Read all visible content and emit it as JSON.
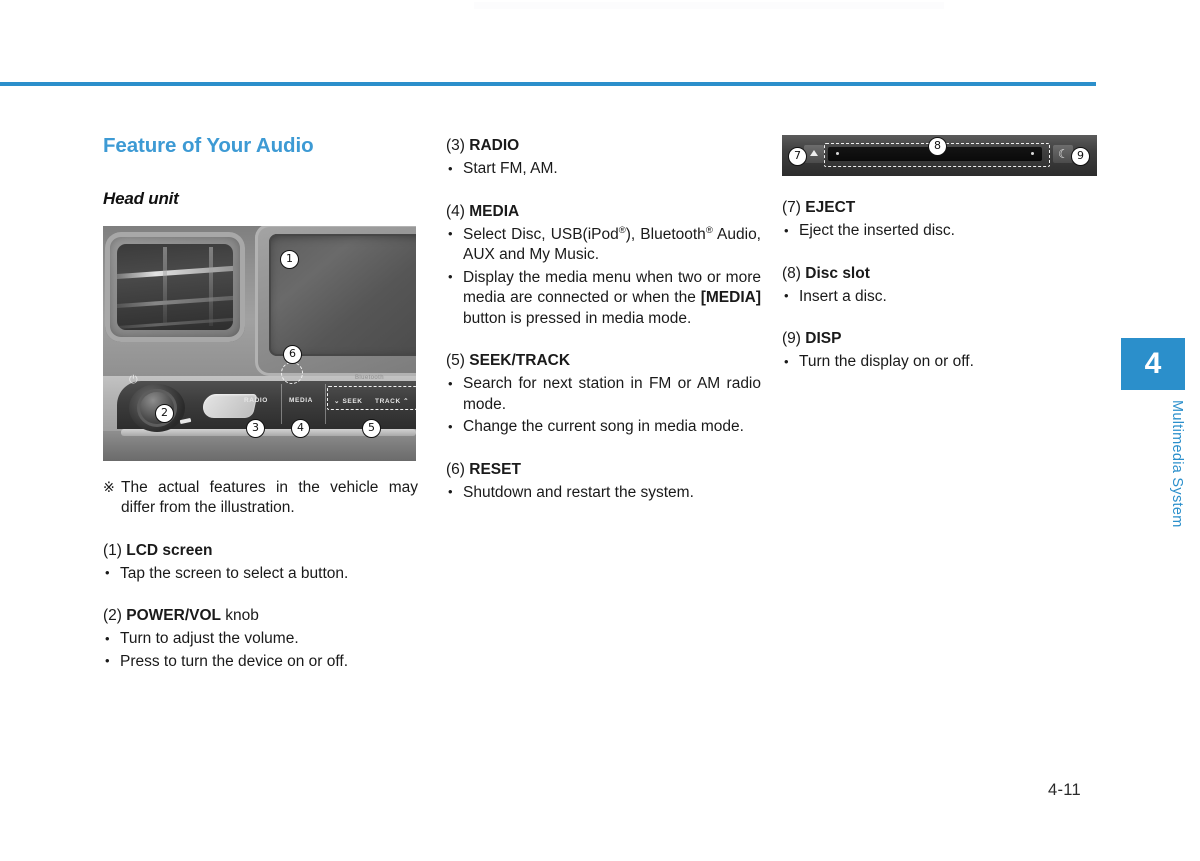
{
  "page": {
    "number": "4-11",
    "chapter_tab": "4",
    "chapter_label": "Multimedia System",
    "accent_color": "#2b8fcb",
    "heading_color": "#3d9ad4"
  },
  "left_column": {
    "section_title": "Feature of Your Audio",
    "sub_title": "Head unit",
    "head_unit_image": {
      "alt": "Head unit with air vent, LCD screen and control panel",
      "callouts": [
        "1",
        "2",
        "3",
        "4",
        "5",
        "6"
      ],
      "key_labels": {
        "radio": "RADIO",
        "media": "MEDIA",
        "seek": "SEEK",
        "track": "TRACK",
        "bluetooth": "Bluetooth",
        "power": "⏻"
      }
    },
    "note": {
      "mark": "※",
      "text": "The actual features in the vehicle may differ from the illustration."
    },
    "items": [
      {
        "num": "(1)",
        "name": "LCD screen",
        "suffix": "",
        "bullets": [
          {
            "text": "Tap the screen to select a button."
          }
        ]
      },
      {
        "num": "(2)",
        "name": "POWER/VOL",
        "suffix": " knob",
        "bullets": [
          {
            "text": "Turn to adjust the volume."
          },
          {
            "text": "Press to turn the device on or off."
          }
        ]
      }
    ]
  },
  "middle_column": {
    "items": [
      {
        "num": "(3)",
        "name": "RADIO",
        "suffix": "",
        "bullets": [
          {
            "text": "Start FM, AM."
          }
        ]
      },
      {
        "num": "(4)",
        "name": "MEDIA",
        "suffix": "",
        "bullets": [
          {
            "html": "Select Disc, USB(iPod<sup>®</sup>), Bluetooth<sup>®</sup> Audio, AUX and My Music."
          },
          {
            "html": "Display the media menu when two or more media are connected or when the <b>[MEDIA]</b> button is pressed in media mode."
          }
        ]
      },
      {
        "num": "(5)",
        "name": "SEEK/TRACK",
        "suffix": "",
        "bullets": [
          {
            "text": "Search for next station in FM or AM radio mode."
          },
          {
            "text": "Change the current song in media mode."
          }
        ]
      },
      {
        "num": "(6)",
        "name": "RESET",
        "suffix": "",
        "bullets": [
          {
            "text": "Shutdown and restart the system."
          }
        ]
      }
    ]
  },
  "right_column": {
    "disc_image": {
      "alt": "Disc slot panel with eject and display buttons",
      "callouts": [
        "7",
        "8",
        "9"
      ],
      "eject_icon": "eject-triangle",
      "disp_icon": "crescent"
    },
    "items": [
      {
        "num": "(7)",
        "name": "EJECT",
        "suffix": "",
        "bullets": [
          {
            "text": "Eject the inserted disc."
          }
        ]
      },
      {
        "num": "(8)",
        "name": "Disc slot",
        "suffix": "",
        "bullets": [
          {
            "text": "Insert a disc."
          }
        ]
      },
      {
        "num": "(9)",
        "name": "DISP",
        "suffix": "",
        "bullets": [
          {
            "text": "Turn the display on or off."
          }
        ]
      }
    ]
  }
}
